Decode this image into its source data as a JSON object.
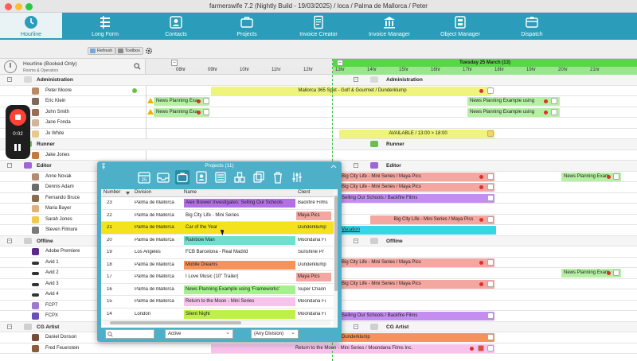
{
  "window": {
    "title": "farmerswife 7.2  (Nightly Build - 19/03/2025) / loca / Palma de Mallorca / Peter"
  },
  "nav": [
    {
      "label": "Hourline",
      "icon": "clock-icon"
    },
    {
      "label": "Long Form",
      "icon": "long-form-icon"
    },
    {
      "label": "Contacts",
      "icon": "contacts-icon"
    },
    {
      "label": "Projects",
      "icon": "briefcase-icon"
    },
    {
      "label": "Invoice Creator",
      "icon": "invoice-creator-icon"
    },
    {
      "label": "Invoice Manager",
      "icon": "bank-icon"
    },
    {
      "label": "Object Manager",
      "icon": "object-manager-icon"
    },
    {
      "label": "Dispatch",
      "icon": "dispatch-icon"
    }
  ],
  "toolbar": {
    "refresh": "Refresh",
    "toolbox": "Toolbox"
  },
  "hourline": {
    "title": "Hourline (Booked Only)",
    "subtitle": "Rooms & Operators",
    "hours_day1": [
      "08hr",
      "09hr",
      "10hr",
      "11hr",
      "12hr"
    ],
    "hours_day2": [
      "13hr",
      "14hr",
      "15hr",
      "16hr",
      "17hr",
      "18hr",
      "19hr",
      "20hr",
      "21hr"
    ],
    "day_header": "Tuesday 25 March (13)"
  },
  "rows": [
    {
      "label": "Administration",
      "group": true
    },
    {
      "label": "Peter Moore"
    },
    {
      "label": "Eric Klein"
    },
    {
      "label": "John Smith"
    },
    {
      "label": "Jane Fonda"
    },
    {
      "label": "Jo White"
    },
    {
      "label": "Runner",
      "group": true
    },
    {
      "label": "Jake Jones"
    },
    {
      "label": "Editor",
      "group": true
    },
    {
      "label": "Anne Novak"
    },
    {
      "label": "Dennis Adam"
    },
    {
      "label": "Fernando Bruce"
    },
    {
      "label": "Maria Bayer"
    },
    {
      "label": "Sarah Jones"
    },
    {
      "label": "Steven Filmore"
    },
    {
      "label": "Offline",
      "group": true
    },
    {
      "label": "Adobe Premiere"
    },
    {
      "label": "Avid 1"
    },
    {
      "label": "Avid 2"
    },
    {
      "label": "Avid 3"
    },
    {
      "label": "Avid 4"
    },
    {
      "label": "FCP7"
    },
    {
      "label": "FCPX"
    },
    {
      "label": "CG Artist",
      "group": true
    },
    {
      "label": "Daniel Donson"
    },
    {
      "label": "Fred Feuerstein"
    }
  ],
  "bookings": {
    "mallorca": "Mallorca 365 Spot - Golf & Gourmet / Dunderklump",
    "news_short": "News Planning Exa",
    "news_long": "News Planning Example using",
    "news_mid": "News Planning Exam",
    "available": "AVAILABLE / 13:00 > 18:00",
    "bigcity": "Big City Life - Mini Series / Maya Pics",
    "schools": "Selling Our Schools / Backfire Films",
    "vacation": "Vacation",
    "dunder": "Dunderklump",
    "moon": "Return to the Moon - Mini Series / Moondana Films Inc."
  },
  "recorder": {
    "time": "0:02"
  },
  "popup": {
    "title": "Projects (11)",
    "columns": [
      "Number",
      "Division",
      "Name",
      "Client"
    ],
    "rows": [
      {
        "number": "23",
        "division": "Palma de Mallorca",
        "name": "Alex Brewer Investigates: Selling Our Schools",
        "client": "Backfire Films",
        "color": "#b36fe6"
      },
      {
        "number": "22",
        "division": "Palma de Mallorca",
        "name": "Big City Life - Mini Series",
        "client": "Maya Pics",
        "color": "#ffffff"
      },
      {
        "number": "21",
        "division": "Palma de Mallorca",
        "name": "Car of the Year",
        "client": "Dunderklump",
        "color": "#f3e21c"
      },
      {
        "number": "20",
        "division": "Palma de Mallorca",
        "name": "Rainbow Man",
        "client": "Moondana Fi",
        "color": "#6fe0cf"
      },
      {
        "number": "19",
        "division": "Los Angeles",
        "name": "FCB Barcelona - Real Madrid",
        "client": "Sunshine Pr",
        "color": "#ffffff"
      },
      {
        "number": "18",
        "division": "Palma de Mallorca",
        "name": "Mobile Dreams",
        "client": "Dunderklump",
        "color": "#f7935a"
      },
      {
        "number": "17",
        "division": "Palma de Mallorca",
        "name": "I Love Music (10\" Trailer)",
        "client": "Maya Pics",
        "color": "#ffffff"
      },
      {
        "number": "16",
        "division": "Palma de Mallorca",
        "name": "News Planning Example using 'Frameworks'",
        "client": "Super Chann",
        "color": "#a6f08f"
      },
      {
        "number": "15",
        "division": "Palma de Mallorca",
        "name": "Return to the Moon - Mini Series",
        "client": "Moondana Fi",
        "color": "#f7c2ec"
      },
      {
        "number": "14",
        "division": "London",
        "name": "Silent Night",
        "client": "Moondana Fi",
        "color": "#bff04a"
      }
    ],
    "filter_status": "Active",
    "filter_division": "(Any Division)",
    "search_placeholder": ""
  }
}
